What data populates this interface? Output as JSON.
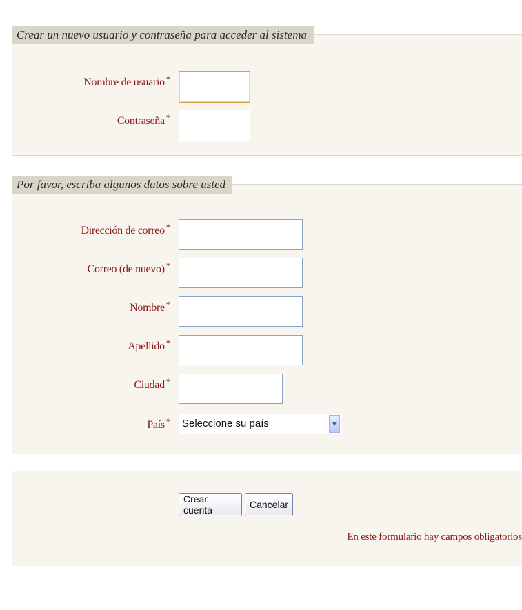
{
  "section_account": {
    "legend": "Crear un nuevo usuario y contraseña para acceder al sistema",
    "fields": [
      {
        "label": "Nombre de usuario",
        "value": ""
      },
      {
        "label": "Contraseña",
        "value": ""
      }
    ]
  },
  "section_details": {
    "legend": "Por favor, escriba algunos datos sobre usted",
    "fields": [
      {
        "label": "Dirección de correo",
        "value": ""
      },
      {
        "label": "Correo (de nuevo)",
        "value": ""
      },
      {
        "label": "Nombre",
        "value": ""
      },
      {
        "label": "Apellido",
        "value": ""
      },
      {
        "label": "Ciudad",
        "value": ""
      }
    ],
    "country": {
      "label": "País",
      "selected": "Seleccione su país"
    }
  },
  "required_marker": "*",
  "buttons": {
    "create": "Crear cuenta",
    "cancel": "Cancelar"
  },
  "required_note": "En este formulario hay campos obligatorios",
  "icons": {
    "select_arrow": "chevron-down-icon"
  },
  "colors": {
    "label": "#8b1a1a",
    "legend_bg": "#d9d5c8",
    "panel_bg": "#f7f5ee",
    "input_border": "#8aa4c6"
  }
}
